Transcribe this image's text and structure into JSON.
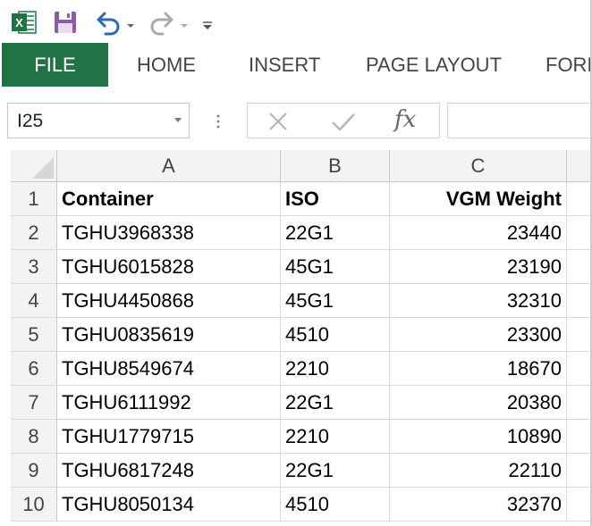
{
  "quick_access": {
    "app_icon": "excel-logo-icon",
    "save_icon": "save-icon",
    "undo_icon": "undo-icon",
    "redo_icon": "redo-icon",
    "customize_icon": "customize-toolbar-icon",
    "excel_green": "#217346",
    "excel_logo_letter": "X"
  },
  "ribbon": {
    "tabs": [
      {
        "label": "FILE"
      },
      {
        "label": "HOME"
      },
      {
        "label": "INSERT"
      },
      {
        "label": "PAGE LAYOUT"
      },
      {
        "label": "FORM"
      }
    ]
  },
  "formula_bar": {
    "name_box": "I25",
    "fx_label": "fx",
    "formula_value": ""
  },
  "sheet": {
    "columns": [
      "A",
      "B",
      "C"
    ],
    "rows": [
      {
        "num": "1",
        "a": "Container",
        "b": "ISO",
        "c": "VGM Weight"
      },
      {
        "num": "2",
        "a": "TGHU3968338",
        "b": "22G1",
        "c": "23440"
      },
      {
        "num": "3",
        "a": "TGHU6015828",
        "b": "45G1",
        "c": "23190"
      },
      {
        "num": "4",
        "a": "TGHU4450868",
        "b": "45G1",
        "c": "32310"
      },
      {
        "num": "5",
        "a": "TGHU0835619",
        "b": "4510",
        "c": "23300"
      },
      {
        "num": "6",
        "a": "TGHU8549674",
        "b": "2210",
        "c": "18670"
      },
      {
        "num": "7",
        "a": "TGHU6111992",
        "b": "22G1",
        "c": "20380"
      },
      {
        "num": "8",
        "a": "TGHU1779715",
        "b": "2210",
        "c": "10890"
      },
      {
        "num": "9",
        "a": "TGHU6817248",
        "b": "22G1",
        "c": "22110"
      },
      {
        "num": "10",
        "a": "TGHU8050134",
        "b": "4510",
        "c": "32370"
      }
    ]
  }
}
